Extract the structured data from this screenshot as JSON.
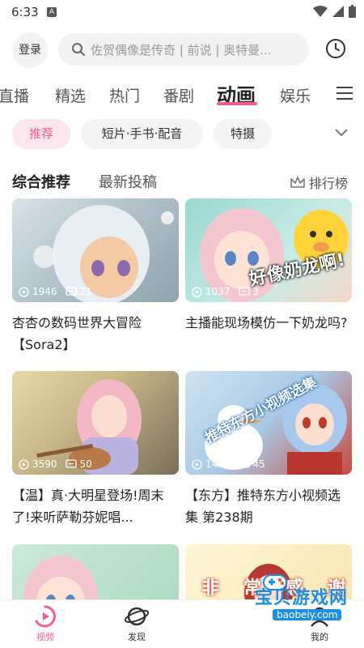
{
  "status": {
    "time": "6:33",
    "a_badge": "A"
  },
  "header": {
    "login": "登录",
    "search_placeholder": "佐贺偶像是传奇 | 前说 | 奥特曼..."
  },
  "main_tabs": [
    "直播",
    "精选",
    "热门",
    "番剧",
    "动画",
    "娱乐"
  ],
  "chips": [
    "推荐",
    "短片·手书·配音",
    "特摄"
  ],
  "section": {
    "tab1": "综合推荐",
    "tab2": "最新投稿",
    "rank": "排行榜"
  },
  "videos": [
    {
      "plays": "1946",
      "comments": "21",
      "title": "杏杏の数码世界大冒险【Sora2】"
    },
    {
      "plays": "1037",
      "comments": "3",
      "title": "主播能现场模仿一下奶龙吗?",
      "overlay": "好像奶龙啊!"
    },
    {
      "plays": "3590",
      "comments": "50",
      "title": "【温】真·大明星登场!周末了!来听萨勒芬妮唱..."
    },
    {
      "plays": "1436",
      "comments": "45",
      "title": "【东方】推特东方小视频选集 第238期",
      "overlay": "推特东方小视频选集"
    },
    {
      "title": "",
      "overlay": ""
    },
    {
      "title": "",
      "overlay": "非常感谢"
    }
  ],
  "nav": {
    "video": "视频",
    "discover": "发现",
    "me": "我的"
  },
  "watermark": {
    "text": "宝贝游戏网",
    "url": "baobeiy.com"
  },
  "colors": {
    "accent": "#f25d8e",
    "chip_active_bg": "#fde6ee"
  }
}
